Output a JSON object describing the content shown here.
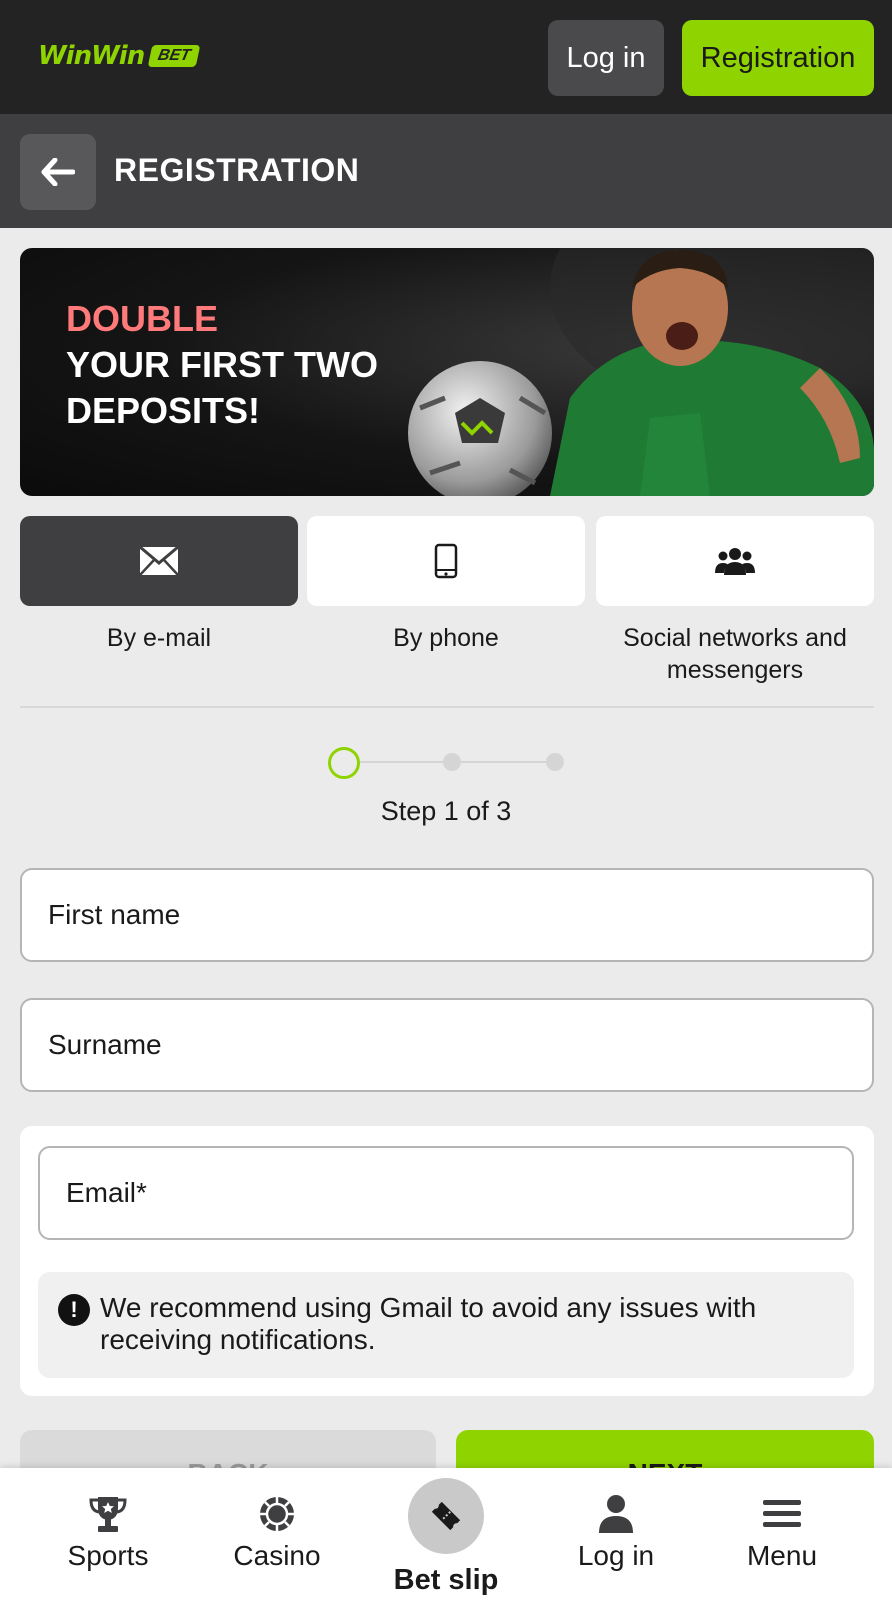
{
  "header": {
    "logo_text": "WinWin",
    "logo_badge": "BET",
    "login_label": "Log in",
    "registration_label": "Registration"
  },
  "subheader": {
    "title": "REGISTRATION"
  },
  "banner": {
    "line1": "DOUBLE",
    "line2": "YOUR FIRST TWO",
    "line3": "DEPOSITS!"
  },
  "methods": [
    {
      "label": "By e-mail",
      "icon": "envelope-icon",
      "active": true
    },
    {
      "label": "By phone",
      "icon": "phone-icon",
      "active": false
    },
    {
      "label": "Social networks and messengers",
      "icon": "users-icon",
      "active": false
    }
  ],
  "steps": {
    "text": "Step 1 of 3",
    "current": 1,
    "total": 3
  },
  "form": {
    "first_name_placeholder": "First name",
    "surname_placeholder": "Surname",
    "email_placeholder": "Email*",
    "notice": "We recommend using Gmail to avoid any issues with receiving notifications."
  },
  "actions": {
    "back_label": "BACK",
    "next_label": "NEXT"
  },
  "bottom_nav": {
    "sports": "Sports",
    "casino": "Casino",
    "bet_slip": "Bet slip",
    "login": "Log in",
    "menu": "Menu"
  },
  "colors": {
    "accent": "#8fd400",
    "header_bg": "#232323",
    "subheader_bg": "#3f3f41",
    "banner_highlight": "#ff7a7a"
  }
}
